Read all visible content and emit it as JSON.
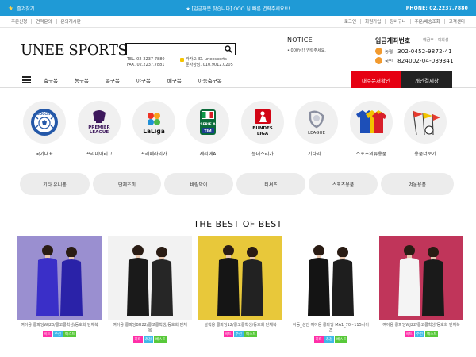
{
  "topbar": {
    "favorite": "즐겨찾기",
    "notice": "★ [입금자분 찾습니다] OOO 님 빠른 연락주세요!!!",
    "phone": "PHONE: 02.2237.7880"
  },
  "util": {
    "left": [
      "주문신청",
      "견적문의",
      "문의게시판"
    ],
    "right": [
      "로그인",
      "회원가입",
      "장바구니",
      "주문/배송조회",
      "고객센터"
    ]
  },
  "header": {
    "logo": "UNEE SPORTS",
    "search_placeholder": "",
    "tel": "TEL. 02-2237-7880",
    "fax": "FAX. 02.2237.7881",
    "kakao": "카카오 ID. uneesports",
    "sms": "문자상담. 010.9012.0205",
    "notice_title": "NOTICE",
    "notice_text": "• 000님!! 연락주세요.",
    "bank_title": "입금계좌번호",
    "bank_holder": "예금주 : 이희성",
    "banks": [
      {
        "name": "농협",
        "number": "302-0452-9872-41"
      },
      {
        "name": "국민",
        "number": "824002-04-039341"
      }
    ]
  },
  "nav": {
    "items": [
      "축구복",
      "농구복",
      "족구복",
      "야구복",
      "배구복",
      "아동축구복"
    ],
    "order_btn": "내주문서확인",
    "pay_btn": "개인결제창"
  },
  "categories": [
    {
      "label": "국가대표",
      "icon": "soccer-emblem"
    },
    {
      "label": "프리미어리그",
      "icon": "premier-league-logo",
      "logo_text": [
        "PREMIER",
        "LEAGUE"
      ]
    },
    {
      "label": "프리메라리가",
      "icon": "laliga-logo",
      "logo_text": "LaLiga"
    },
    {
      "label": "세리에A",
      "icon": "serie-a-logo",
      "logo_text": [
        "SERIE A",
        "TIM"
      ]
    },
    {
      "label": "분데스리가",
      "icon": "bundesliga-logo",
      "logo_text": [
        "BUNDES",
        "LIGA"
      ]
    },
    {
      "label": "기타리그",
      "icon": "ligue-logo",
      "logo_text": "LEAGUE"
    },
    {
      "label": "스포츠의류용품",
      "icon": "jersey-icon"
    },
    {
      "label": "용품더보기",
      "icon": "equipment-icon"
    }
  ],
  "pills": [
    "기타 유니폼",
    "단체조끼",
    "바람막이",
    "티셔츠",
    "스포츠용품",
    "겨울용품"
  ],
  "best_title": "THE BEST OF BEST",
  "products": [
    {
      "name": "여아용 롱파딩WJ23/롱고롱학생/동호회 단체복",
      "badges": [
        "히트",
        "추천",
        "베스트"
      ],
      "bg": "#9a8fd0",
      "coat": "#3a2fc8",
      "coat2": "#2a22a8"
    },
    {
      "name": "여아용 롱파딩BU22/롱고롱학생/동호회 단체복",
      "badges": [
        "히트",
        "추천",
        "베스트"
      ],
      "bg": "#f2f2f2",
      "coat": "#1a1a1a",
      "coat2": "#262626"
    },
    {
      "name": "블랙용 롱파딩12/롱고롱학생/동호회 단체복",
      "badges": [
        "히트",
        "추천",
        "베스트"
      ],
      "bg": "#e8c83a",
      "coat": "#151515",
      "coat2": "#222"
    },
    {
      "name": "아동_성인 여아용 롱파딩 MA1_70~115사이즈",
      "badges": [
        "히트",
        "추천",
        "베스트"
      ],
      "bg": "#ffffff",
      "coat": "#141414",
      "coat2": "#1e1e1e"
    },
    {
      "name": "여아용 롱파딩WJ22/롱고롱학생/동호회 단체복",
      "badges": [
        "히트",
        "추천",
        "베스트"
      ],
      "bg": "#c0355a",
      "coat": "#f4f4f4",
      "coat2": "#1a1a1a"
    }
  ],
  "badge_colors": [
    "#ff2fa8",
    "#3fb8e8",
    "#58c93a"
  ]
}
